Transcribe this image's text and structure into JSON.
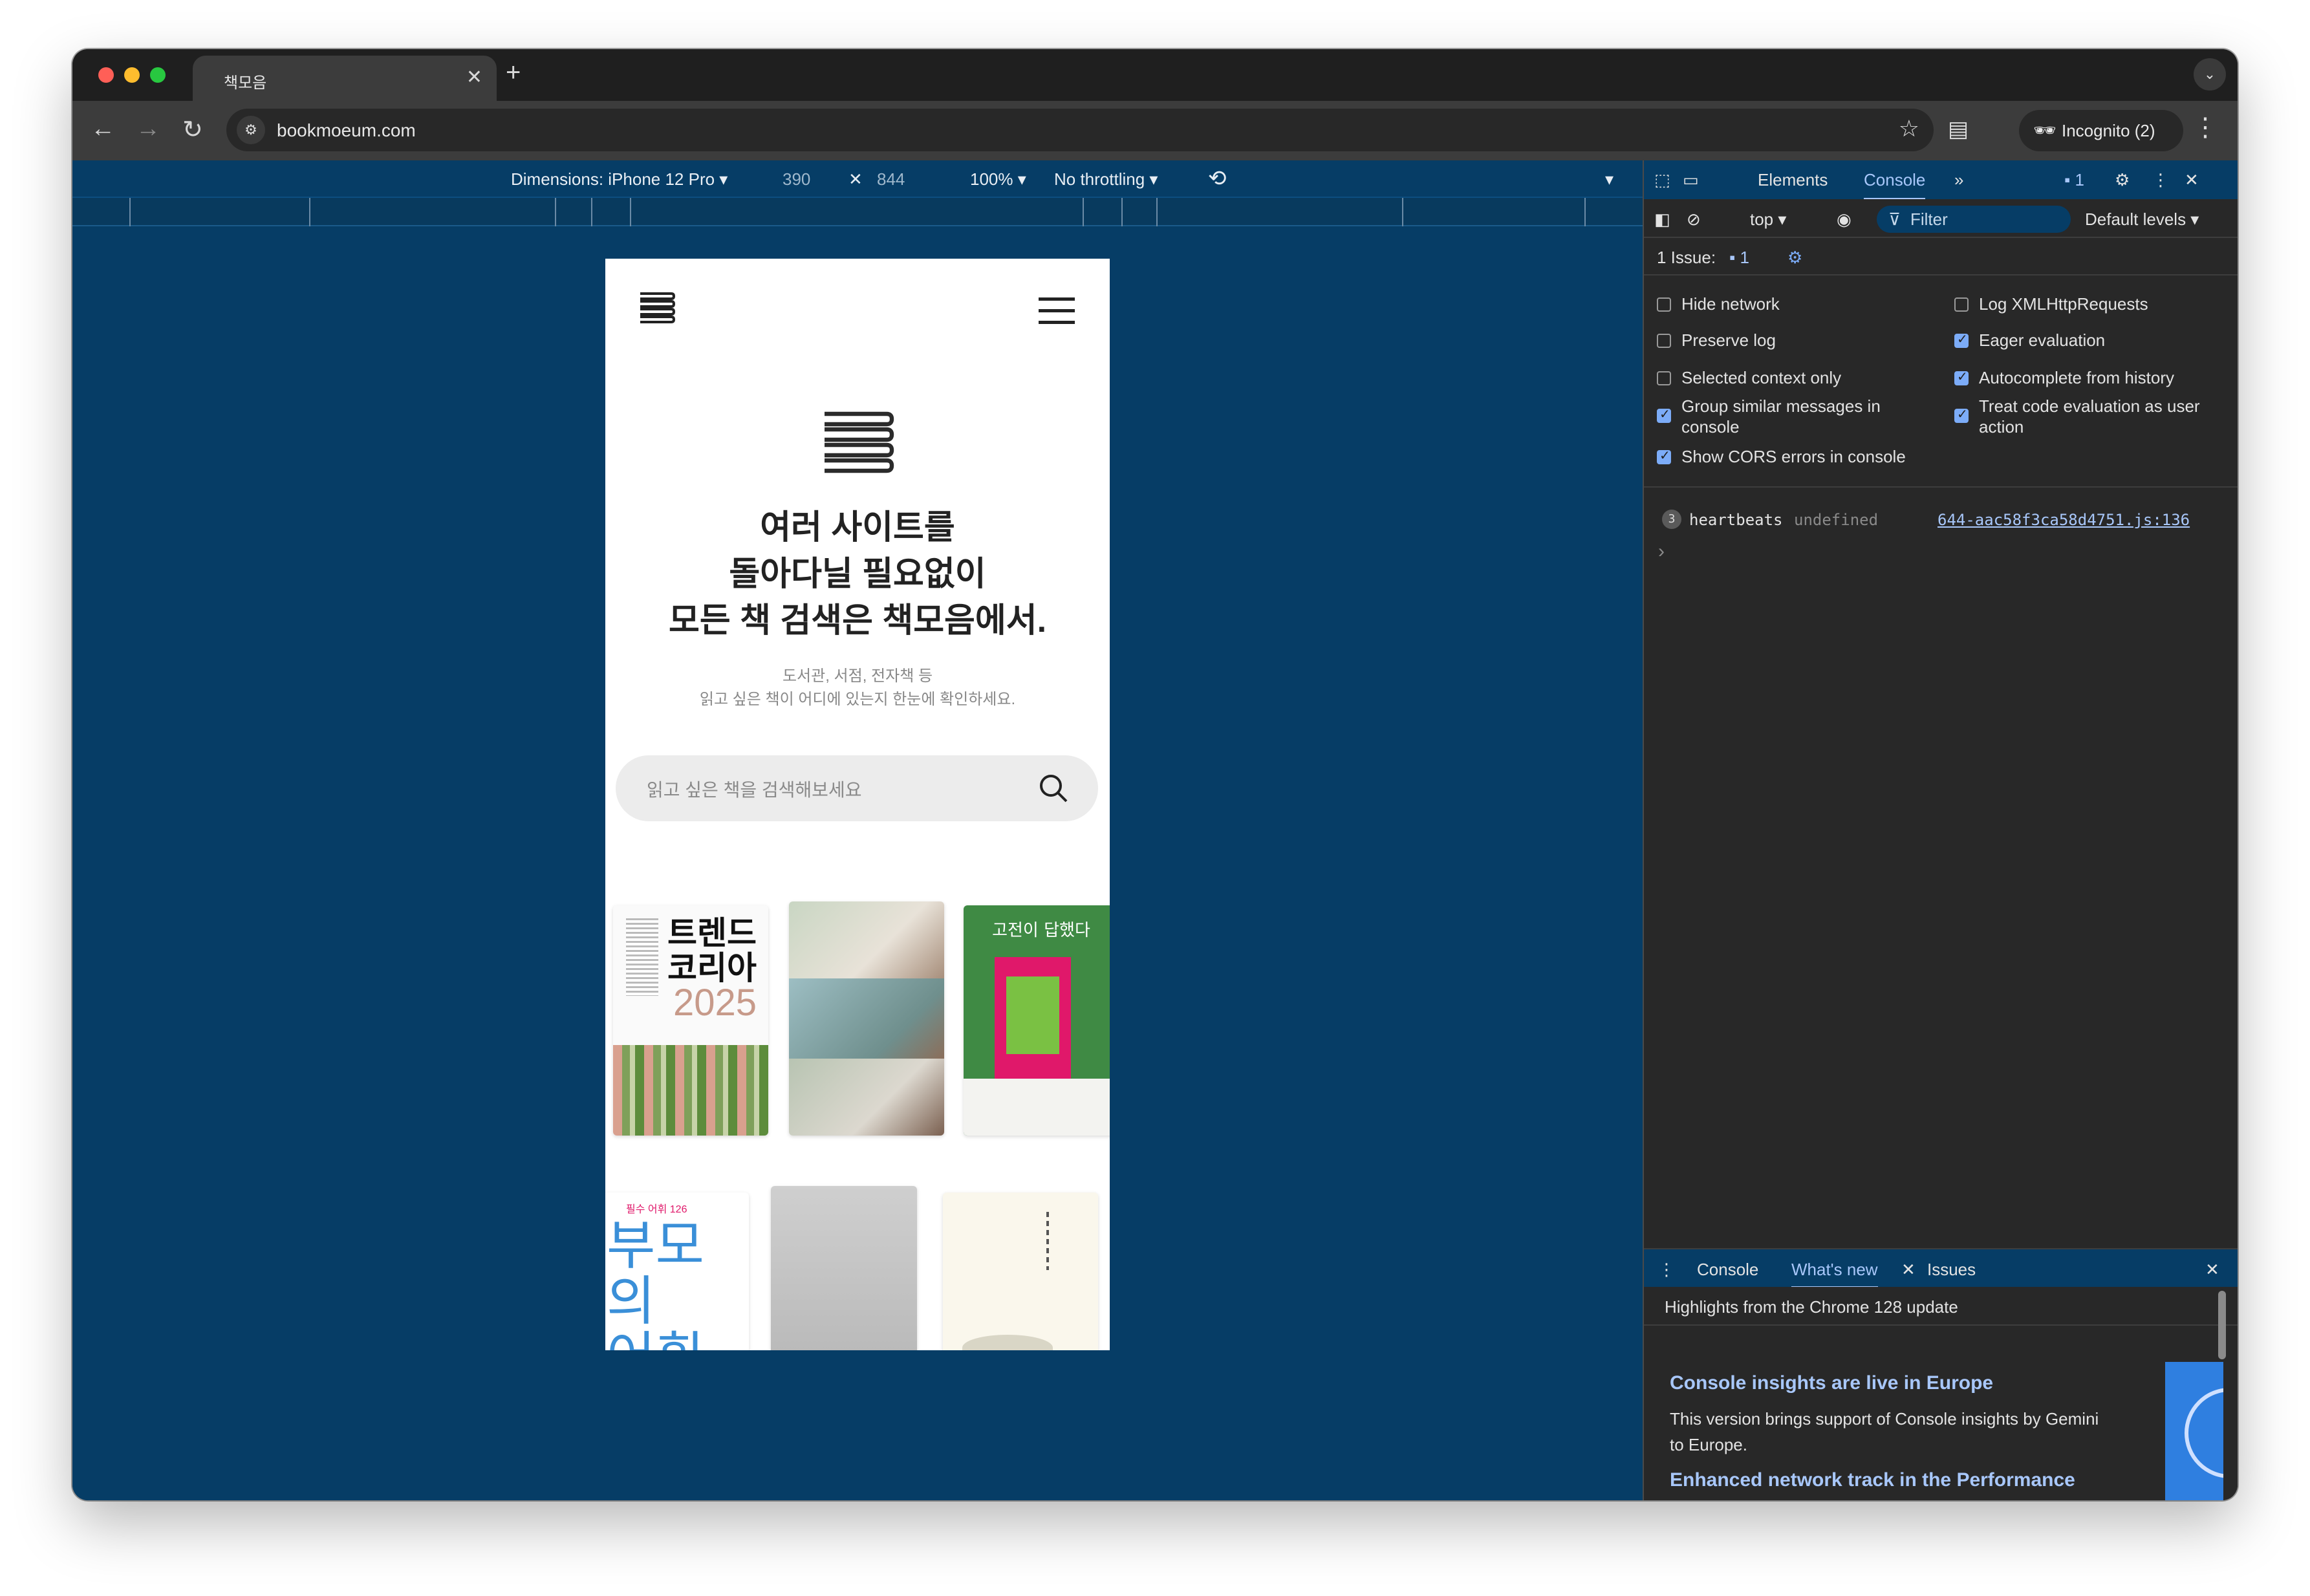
{
  "browser": {
    "tab_title": "책모음",
    "url": "bookmoeum.com",
    "incognito_label": "Incognito (2)"
  },
  "device_toolbar": {
    "dimensions_label": "Dimensions: iPhone 12 Pro",
    "width": "390",
    "height": "844",
    "zoom": "100%",
    "throttling": "No throttling"
  },
  "page": {
    "headline_lines": [
      "여러 사이트를",
      "돌아다닐 필요없이",
      "모든 책 검색은 책모음에서."
    ],
    "sub_lines": [
      "도서관, 서점, 전자책 등",
      "읽고 싶은 책이 어디에 있는지 한눈에 확인하세요."
    ],
    "search_placeholder": "읽고 싶은 책을 검색해보세요",
    "books": [
      {
        "title_lines": [
          "트렌드",
          "코리아",
          "2025"
        ]
      },
      {
        "title_lines": [
          ""
        ]
      },
      {
        "title_lines": [
          "고전이 답했다"
        ]
      },
      {
        "title_lines": [
          "부모의",
          "어휘력"
        ],
        "badge": "필수 어휘 126"
      },
      {
        "title_lines": [
          ""
        ]
      },
      {
        "title_lines": [
          ""
        ]
      }
    ]
  },
  "devtools": {
    "tabs": {
      "elements": "Elements",
      "console": "Console"
    },
    "messages_count": "1",
    "context": "top",
    "filter_placeholder": "Filter",
    "levels": "Default levels",
    "issues_label": "1 Issue:",
    "issues_count": "1",
    "options_left": [
      {
        "label": "Hide network",
        "checked": false
      },
      {
        "label": "Preserve log",
        "checked": false
      },
      {
        "label": "Selected context only",
        "checked": false
      },
      {
        "label": "Group similar messages in console",
        "checked": true
      },
      {
        "label": "Show CORS errors in console",
        "checked": true
      }
    ],
    "options_right": [
      {
        "label": "Log XMLHttpRequests",
        "checked": false
      },
      {
        "label": "Eager evaluation",
        "checked": true
      },
      {
        "label": "Autocomplete from history",
        "checked": true
      },
      {
        "label": "Treat code evaluation as user action",
        "checked": true
      }
    ],
    "log": {
      "count": "3",
      "name": "heartbeats",
      "value": "undefined",
      "source": "644-aac58f3ca58d4751.js:136"
    },
    "prompt": "›",
    "drawer": {
      "tabs": [
        "Console",
        "What's new",
        "Issues"
      ],
      "highlights": "Highlights from the Chrome 128 update",
      "heading1": "Console insights are live in Europe",
      "body1": "This version brings support of Console insights by Gemini to Europe.",
      "heading2": "Enhanced network track in the Performance"
    }
  },
  "colors": {
    "device_bg": "#063d66",
    "accent": "#7cacf8"
  }
}
